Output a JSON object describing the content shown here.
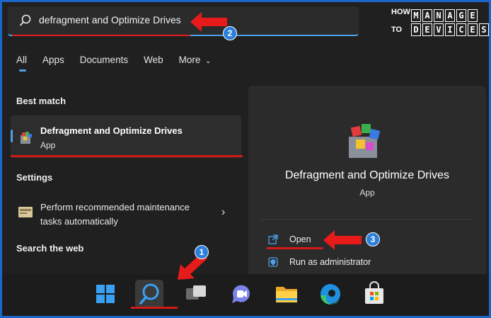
{
  "search": {
    "query": "defragment and Optimize Drives"
  },
  "logo": {
    "how": "HOW",
    "to": "TO",
    "row1": [
      "M",
      "A",
      "N",
      "A",
      "G",
      "E"
    ],
    "row2": [
      "D",
      "E",
      "V",
      "I",
      "C",
      "E",
      "S"
    ]
  },
  "tabs": [
    {
      "label": "All",
      "active": true
    },
    {
      "label": "Apps"
    },
    {
      "label": "Documents"
    },
    {
      "label": "Web"
    },
    {
      "label": "More",
      "has_chevron": true
    }
  ],
  "left": {
    "best_match_heading": "Best match",
    "best_match": {
      "title": "Defragment and Optimize Drives",
      "subtitle": "App"
    },
    "settings_heading": "Settings",
    "setting_item": "Perform recommended maintenance tasks automatically",
    "search_web_heading": "Search the web"
  },
  "right": {
    "app_title": "Defragment and Optimize Drives",
    "app_subtitle": "App",
    "actions": [
      {
        "label": "Open",
        "icon": "open-external-icon"
      },
      {
        "label": "Run as administrator",
        "icon": "shield-admin-icon"
      }
    ]
  },
  "taskbar": [
    {
      "name": "windows-start-icon"
    },
    {
      "name": "search-icon",
      "active": true
    },
    {
      "name": "task-view-icon"
    },
    {
      "name": "teams-chat-icon"
    },
    {
      "name": "file-explorer-icon"
    },
    {
      "name": "edge-icon"
    },
    {
      "name": "store-icon"
    }
  ],
  "annotations": [
    "1",
    "2",
    "3"
  ],
  "colors": {
    "accent": "#4ea1e8",
    "annotation_red": "#e81b1b",
    "badge_blue": "#2b7fdc"
  }
}
